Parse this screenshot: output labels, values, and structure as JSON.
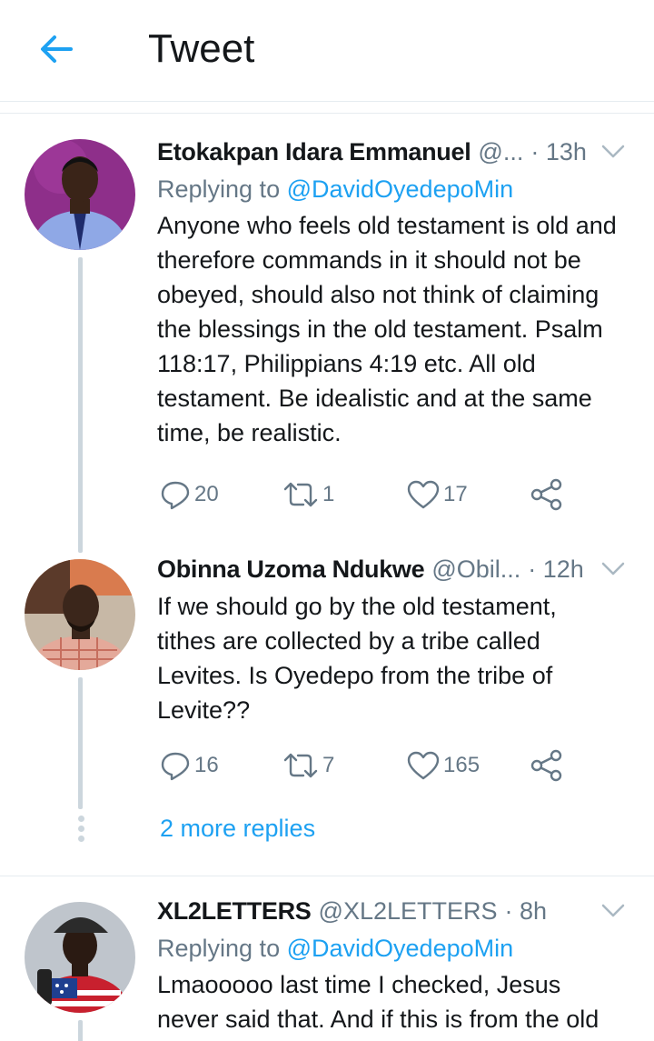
{
  "header": {
    "title": "Tweet",
    "back_icon": "arrow-left-icon",
    "accent": "#1da1f2"
  },
  "tweets": [
    {
      "name": "Etokakpan Idara Emmanuel",
      "handle": "@...",
      "time": "· 13h",
      "replying_prefix": "Replying to ",
      "replying_to": "@DavidOyedepoMin",
      "text": "Anyone who feels old testament is old and therefore commands in it should not be obeyed, should also not think of claiming the blessings in the old testament. Psalm 118:17, Philippians 4:19 etc. All old testament. Be idealistic and at the same time, be realistic.",
      "replies": "20",
      "retweets": "1",
      "likes": "17"
    },
    {
      "name": "Obinna Uzoma Ndukwe",
      "handle": "@Obil...",
      "time": "· 12h",
      "text": "If we should go by the old testament, tithes are collected by a tribe called Levites. Is Oyedepo from the tribe of Levite??",
      "replies": "16",
      "retweets": "7",
      "likes": "165"
    },
    {
      "name": "XL2LETTERS",
      "handle": "@XL2LETTERS",
      "time": "· 8h",
      "replying_prefix": "Replying to ",
      "replying_to": "@DavidOyedepoMin",
      "text": "Lmaooooo last time I checked, Jesus never said that. And if this is from the old"
    }
  ],
  "more_replies": "2 more replies",
  "colors": {
    "text": "#14171a",
    "muted": "#657786",
    "link": "#1da1f2",
    "line": "#ccd6dd"
  }
}
